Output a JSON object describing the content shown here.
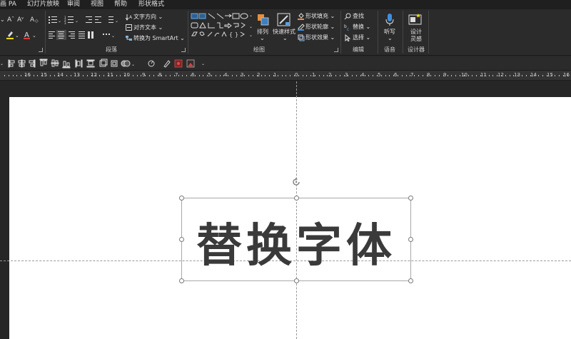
{
  "menu": {
    "tabs": [
      "画 PA",
      "幻灯片放映",
      "审阅",
      "视图",
      "帮助",
      "形状格式"
    ]
  },
  "ribbon": {
    "paragraph": {
      "text_direction": "文字方向",
      "align_text": "对齐文本",
      "convert_smartart": "转换为 SmartArt",
      "group_label": "段落"
    },
    "drawing": {
      "arrange": "排列",
      "quick_styles": "快速样式",
      "shape_fill": "形状填充",
      "shape_outline": "形状轮廓",
      "shape_effects": "形状效果",
      "group_label": "绘图"
    },
    "editing": {
      "find": "查找",
      "replace": "替换",
      "select": "选择",
      "group_label": "编辑"
    },
    "voice": {
      "dictate": "听写",
      "group_label": "语音"
    },
    "designer": {
      "designer_line1": "设计",
      "designer_line2": "灵感",
      "group_label": "设计器"
    }
  },
  "ruler": {
    "labels": [
      "16",
      "15",
      "14",
      "13",
      "12",
      "11",
      "10",
      "9",
      "8",
      "7",
      "6",
      "5",
      "4",
      "3",
      "2",
      "1",
      "0",
      "1",
      "2",
      "3",
      "4",
      "5",
      "6",
      "7",
      "8",
      "9",
      "10",
      "11",
      "12",
      "13",
      "14",
      "15",
      "16"
    ]
  },
  "slide": {
    "text": "替换字体"
  },
  "colors": {
    "background": "#262626",
    "ribbon": "#2b2b2b",
    "highlight_yellow": "#f5d90a",
    "font_red": "#e03a3a",
    "dictate_blue": "#3d8fe0"
  }
}
